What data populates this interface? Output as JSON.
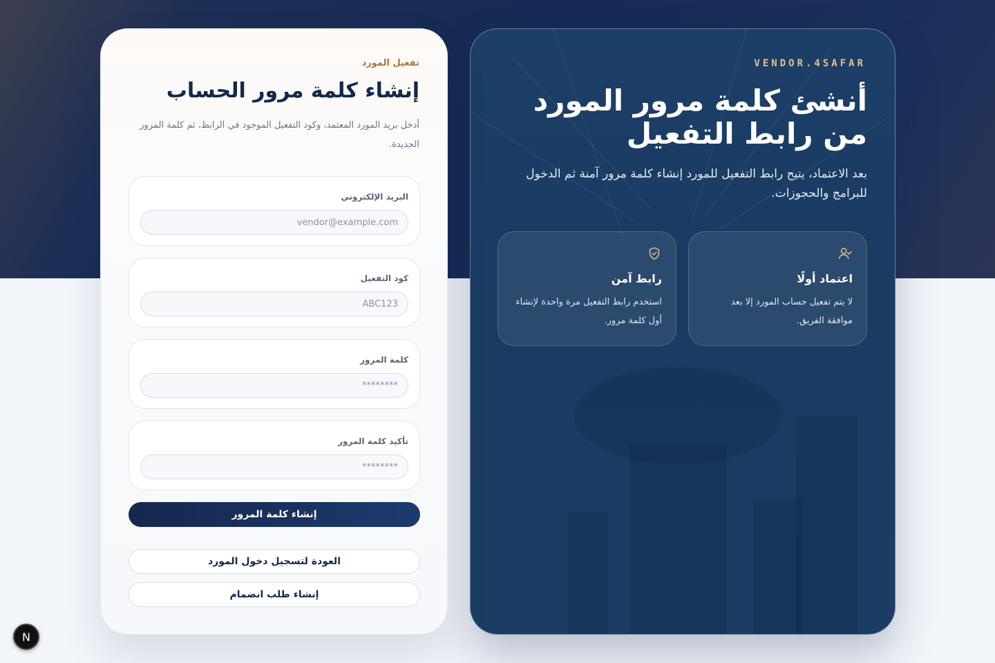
{
  "hero": {
    "brand": "VENDOR.4SAFAR",
    "title": "أنشئ كلمة مرور المورد من رابط التفعيل",
    "subtitle": "بعد الاعتماد، يتيح رابط التفعيل للمورد إنشاء كلمة مرور آمنة ثم الدخول للبرامج والحجوزات.",
    "features": [
      {
        "icon": "user-check-icon",
        "title": "اعتماد أولًا",
        "text": "لا يتم تفعيل حساب المورد إلا بعد موافقة الفريق."
      },
      {
        "icon": "shield-check-icon",
        "title": "رابط آمن",
        "text": "استخدم رابط التفعيل مرة واحدة لإنشاء أول كلمة مرور."
      }
    ]
  },
  "form": {
    "eyebrow": "تفعيل المورد",
    "title": "إنشاء كلمة مرور الحساب",
    "description": "أدخل بريد المورد المعتمد، وكود التفعيل الموجود في الرابط، ثم كلمة المرور الجديدة.",
    "fields": [
      {
        "label": "البريد الإلكتروني",
        "placeholder": "vendor@example.com"
      },
      {
        "label": "كود التفعيل",
        "placeholder": "ABC123"
      },
      {
        "label": "كلمة المرور",
        "placeholder": "********"
      },
      {
        "label": "تأكيد كلمة المرور",
        "placeholder": "********"
      }
    ],
    "submit_label": "إنشاء كلمة المرور",
    "back_label": "العودة لتسجيل دخول المورد",
    "join_label": "إنشاء طلب انضمام"
  },
  "dev_badge": "N",
  "colors": {
    "navy": "#13284b",
    "accent_gold": "#e2c08e",
    "eyebrow_brown": "#a8773f",
    "hero_panel": "#1b3c63"
  }
}
